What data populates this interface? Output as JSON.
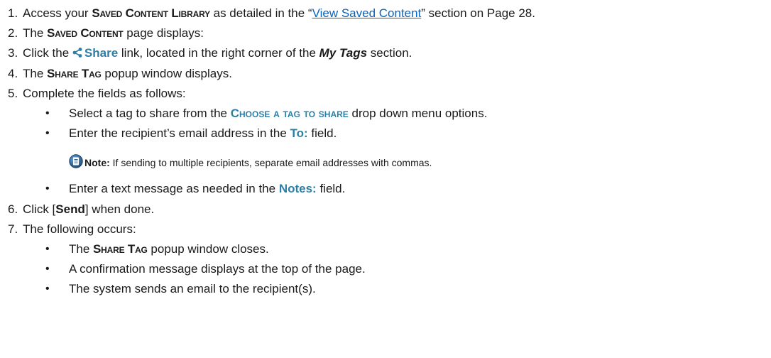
{
  "steps": {
    "s1": {
      "num": "1.",
      "pre": "Access your ",
      "bold": "Saved Content Library",
      "mid": " as detailed in the “",
      "link": "View Saved Content",
      "post": "” section on Page 28."
    },
    "s2": {
      "num": "2.",
      "pre": "The ",
      "bold": "Saved Content",
      "post": " page displays:"
    },
    "s3": {
      "num": "3.",
      "pre": "Click the ",
      "share": "Share",
      "mid": " link, located in the right corner of the ",
      "tag": "My Tags",
      "post": " section."
    },
    "s4": {
      "num": "4.",
      "pre": "The ",
      "bold": "Share Tag",
      "post": " popup window displays."
    },
    "s5": {
      "num": "5.",
      "text": "Complete the fields as follows:",
      "bullets": {
        "b1": {
          "pre": "Select a tag to share from the ",
          "bold": "Choose a tag to share",
          "post": " drop down menu options."
        },
        "b2": {
          "pre": "Enter the recipient’s email address in the ",
          "bold": "To:",
          "post": " field."
        },
        "note": {
          "label": "Note:",
          "text": " If sending to multiple recipients, separate email addresses with commas."
        },
        "b3": {
          "pre": "Enter a text message as needed in the ",
          "bold": "Notes:",
          "post": " field."
        }
      }
    },
    "s6": {
      "num": "6.",
      "pre": "Click [",
      "bold": "Send",
      "post": "] when done."
    },
    "s7": {
      "num": "7.",
      "text": "The following occurs:",
      "bullets": {
        "b1": {
          "pre": "The ",
          "bold": "Share Tag",
          "post": " popup window closes."
        },
        "b2": {
          "text": "A confirmation message displays at the top of the page."
        },
        "b3": {
          "text": "The system sends an email to the recipient(s)."
        }
      }
    }
  },
  "bullet_glyph": "•",
  "icons": {
    "share": "share-icon",
    "note": "note-icon"
  },
  "colors": {
    "accent": "#2e7fa6",
    "link": "#0563c1",
    "text": "#1a1a1a"
  }
}
